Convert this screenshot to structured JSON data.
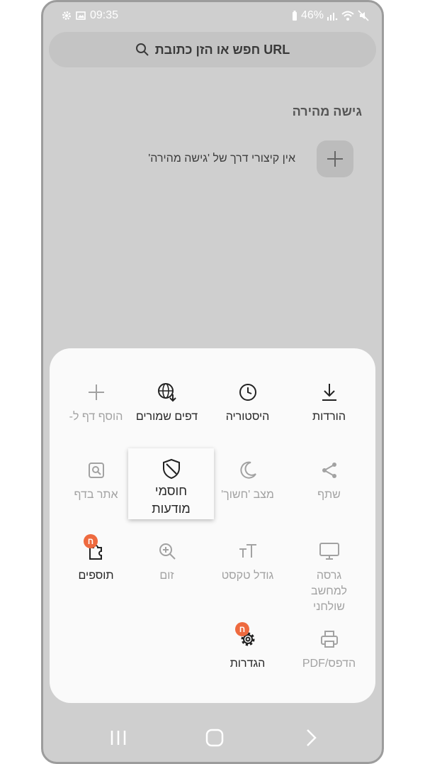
{
  "status": {
    "battery": "46%",
    "time": "09:35"
  },
  "search": {
    "placeholder": "חפש או הזן כתובת URL"
  },
  "quick_access": {
    "title": "גישה מהירה",
    "empty": "אין קיצורי דרך של 'גישה מהירה'"
  },
  "menu": {
    "items": [
      {
        "label": "הורדות",
        "icon": "download-icon",
        "enabled": true
      },
      {
        "label": "היסטוריה",
        "icon": "history-clock-icon",
        "enabled": true
      },
      {
        "label": "דפים שמורים",
        "icon": "saved-pages-globe-icon",
        "enabled": true
      },
      {
        "label": "הוסף דף ל-",
        "icon": "plus-icon",
        "enabled": false
      },
      {
        "label": "שתף",
        "icon": "share-icon",
        "enabled": false
      },
      {
        "label": "מצב 'חשוך'",
        "icon": "moon-icon",
        "enabled": false
      },
      {
        "label": "אתר בדף",
        "icon": "find-in-page-icon",
        "enabled": false
      },
      {
        "label": "גרסה למחשב שולחני",
        "icon": "desktop-icon",
        "enabled": false
      },
      {
        "label": "גודל טקסט",
        "icon": "text-size-icon",
        "enabled": false
      },
      {
        "label": "זום",
        "icon": "zoom-icon",
        "enabled": false
      },
      {
        "label": "תוספים",
        "icon": "add-ons-puzzle-icon",
        "enabled": true,
        "badge": "ח"
      },
      {
        "label": "הדפס/PDF",
        "icon": "print-icon",
        "enabled": false
      },
      {
        "label": "הגדרות",
        "icon": "settings-gear-icon",
        "enabled": true,
        "badge": "ח"
      }
    ],
    "tooltip": {
      "label": "חוסמי מודעות",
      "icon": "ad-blocker-shield-icon"
    }
  },
  "colors": {
    "accent_badge": "#ee6a3f",
    "sheet": "#fafafa",
    "dim_overlay": "#cfcfcf"
  }
}
